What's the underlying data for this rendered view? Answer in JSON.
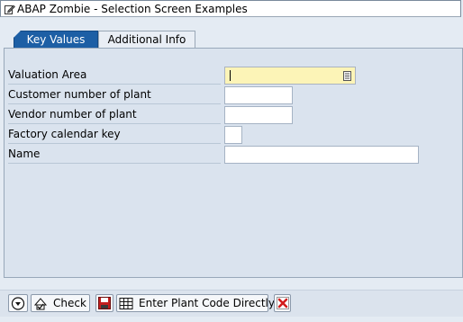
{
  "window": {
    "title": "ABAP Zombie - Selection Screen Examples"
  },
  "tabs": [
    {
      "label": "Key Values",
      "active": true
    },
    {
      "label": "Additional Info",
      "active": false
    }
  ],
  "fields": [
    {
      "label": "Valuation Area",
      "value": "",
      "required": true
    },
    {
      "label": "Customer number of plant",
      "value": ""
    },
    {
      "label": "Vendor number of plant",
      "value": ""
    },
    {
      "label": "Factory calendar key",
      "value": ""
    },
    {
      "label": "Name",
      "value": ""
    }
  ],
  "toolbar": {
    "execute_icon": "execute-icon",
    "check_label": "Check",
    "save_icon": "save-icon",
    "enter_plant_label": "Enter Plant Code Directly",
    "cancel_icon": "cancel-icon"
  },
  "colors": {
    "tab_active": "#1d5fa5",
    "required_field": "#fcf4b7",
    "background": "#e4ebf3",
    "cancel_red": "#d21d1d"
  }
}
